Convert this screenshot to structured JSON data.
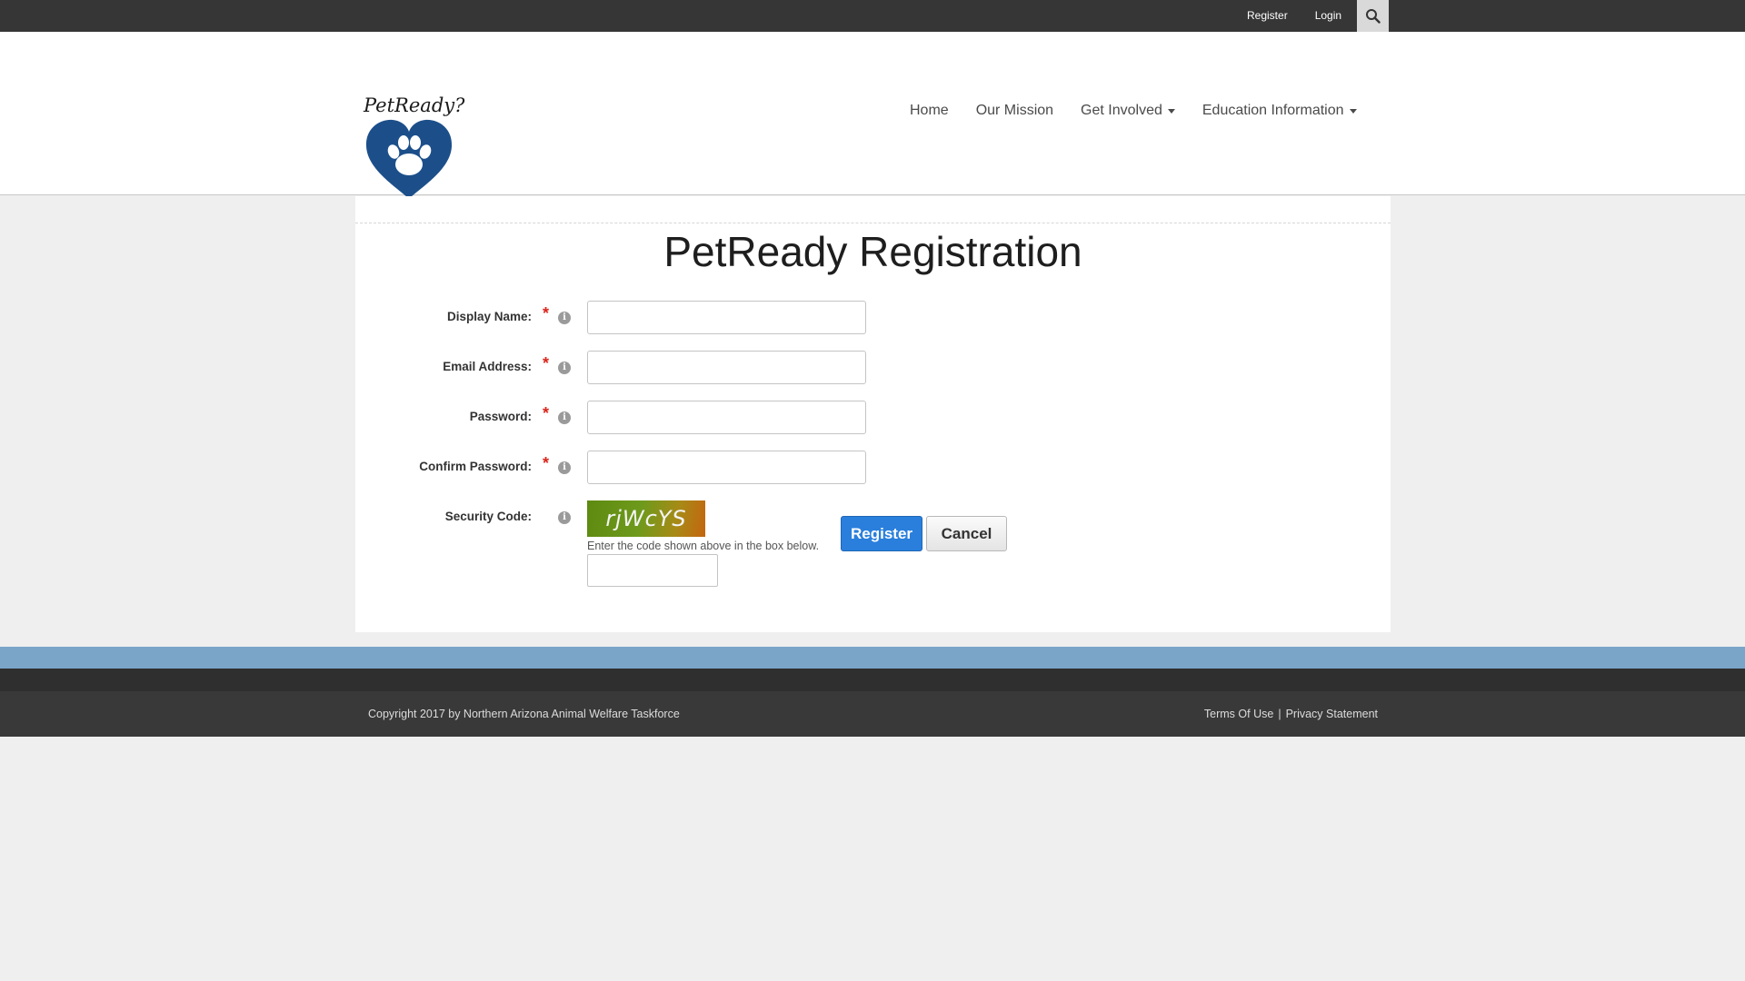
{
  "topbar": {
    "register_label": "Register",
    "login_label": "Login",
    "search_icon": "search-icon"
  },
  "header": {
    "logo_text": "PetReady?",
    "logo_icon": "paw-heart-icon",
    "nav": {
      "home": "Home",
      "mission": "Our Mission",
      "get_involved": "Get Involved",
      "education": "Education Information"
    }
  },
  "form": {
    "title": "PetReady Registration",
    "fields": {
      "display_name": {
        "label": "Display Name:",
        "required": "*",
        "value": ""
      },
      "email": {
        "label": "Email Address:",
        "required": "*",
        "value": ""
      },
      "password": {
        "label": "Password:",
        "required": "*",
        "value": ""
      },
      "confirm_password": {
        "label": "Confirm Password:",
        "required": "*",
        "value": ""
      }
    },
    "security": {
      "label": "Security Code:",
      "captcha_text": "rjWcYS",
      "help_text": "Enter the code shown above in the box below."
    },
    "info_glyph": "i",
    "register_button": "Register",
    "cancel_button": "Cancel"
  },
  "footer": {
    "copyright": "Copyright 2017 by Northern Arizona Animal Welfare Taskforce",
    "terms": "Terms Of Use",
    "separator": "|",
    "privacy": "Privacy Statement"
  },
  "colors": {
    "topbar": "#363636",
    "accent_blue": "#2a7fdc",
    "logo_blue": "#1c4f8a",
    "footer_stripe": "#7ba4c9",
    "required_red": "#d9261c"
  }
}
